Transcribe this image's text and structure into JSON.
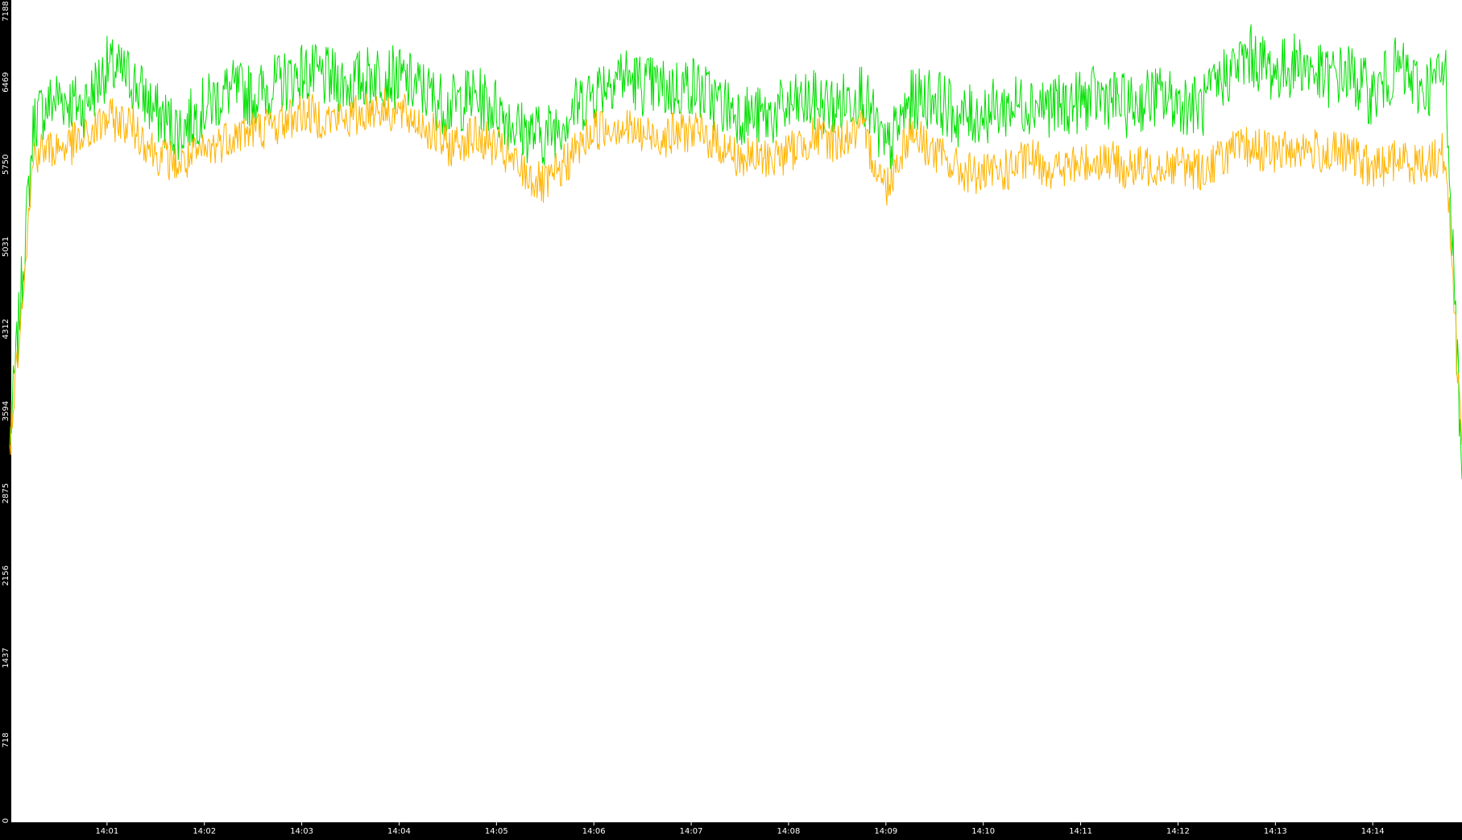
{
  "chart_data": {
    "type": "line",
    "title": "",
    "xlabel": "",
    "ylabel": "",
    "x_ticks": [
      "14:01",
      "14:02",
      "14:03",
      "14:04",
      "14:05",
      "14:06",
      "14:07",
      "14:08",
      "14:09",
      "14:10",
      "14:11",
      "14:12",
      "14:13",
      "14:14"
    ],
    "y_ticks": [
      "0",
      "718",
      "1437",
      "2156",
      "2875",
      "3594",
      "4312",
      "5031",
      "5750",
      "6469",
      "7188"
    ],
    "ylim": [
      0,
      7188
    ],
    "xlim": [
      "14:00:01",
      "14:14:55"
    ],
    "grid": false,
    "background": "#ffffff",
    "frame_color": "#000000",
    "tick_label_color": "#ffffff",
    "series": [
      {
        "color": "#00e000",
        "x": [
          "14:00:00",
          "14:00:15",
          "14:00:30",
          "14:00:45",
          "14:01:00",
          "14:01:15",
          "14:01:30",
          "14:01:45",
          "14:02:00",
          "14:02:15",
          "14:02:30",
          "14:02:45",
          "14:03:00",
          "14:03:15",
          "14:03:30",
          "14:03:45",
          "14:04:00",
          "14:04:15",
          "14:04:30",
          "14:04:45",
          "14:05:00",
          "14:05:15",
          "14:05:30",
          "14:05:45",
          "14:06:00",
          "14:06:15",
          "14:06:30",
          "14:06:45",
          "14:07:00",
          "14:07:15",
          "14:07:30",
          "14:07:45",
          "14:08:00",
          "14:08:15",
          "14:08:30",
          "14:08:45",
          "14:09:00",
          "14:09:15",
          "14:09:30",
          "14:09:45",
          "14:10:00",
          "14:10:15",
          "14:10:30",
          "14:10:45",
          "14:11:00",
          "14:11:15",
          "14:11:30",
          "14:11:45",
          "14:12:00",
          "14:12:15",
          "14:12:30",
          "14:12:45",
          "14:13:00",
          "14:13:15",
          "14:13:30",
          "14:13:45",
          "14:14:00",
          "14:14:15",
          "14:14:30",
          "14:14:45",
          "14:14:55"
        ],
        "values": [
          3300,
          6150,
          6350,
          6250,
          6600,
          6500,
          6200,
          6050,
          6250,
          6400,
          6350,
          6450,
          6550,
          6500,
          6450,
          6550,
          6500,
          6400,
          6250,
          6350,
          6250,
          6050,
          6000,
          6200,
          6400,
          6550,
          6450,
          6400,
          6450,
          6300,
          6200,
          6150,
          6250,
          6300,
          6250,
          6400,
          5850,
          6300,
          6350,
          6150,
          6200,
          6250,
          6300,
          6250,
          6300,
          6350,
          6250,
          6350,
          6300,
          6250,
          6550,
          6700,
          6550,
          6650,
          6500,
          6550,
          6350,
          6600,
          6400,
          6550,
          3000
        ]
      },
      {
        "color": "#ffb400",
        "x": [
          "14:00:00",
          "14:00:15",
          "14:00:30",
          "14:00:45",
          "14:01:00",
          "14:01:15",
          "14:01:30",
          "14:01:45",
          "14:02:00",
          "14:02:15",
          "14:02:30",
          "14:02:45",
          "14:03:00",
          "14:03:15",
          "14:03:30",
          "14:03:45",
          "14:04:00",
          "14:04:15",
          "14:04:30",
          "14:04:45",
          "14:05:00",
          "14:05:15",
          "14:05:30",
          "14:05:45",
          "14:06:00",
          "14:06:15",
          "14:06:30",
          "14:06:45",
          "14:07:00",
          "14:07:15",
          "14:07:30",
          "14:07:45",
          "14:08:00",
          "14:08:15",
          "14:08:30",
          "14:08:45",
          "14:09:00",
          "14:09:15",
          "14:09:30",
          "14:09:45",
          "14:10:00",
          "14:10:15",
          "14:10:30",
          "14:10:45",
          "14:11:00",
          "14:11:15",
          "14:11:30",
          "14:11:45",
          "14:12:00",
          "14:12:15",
          "14:12:30",
          "14:12:45",
          "14:13:00",
          "14:13:15",
          "14:13:30",
          "14:13:45",
          "14:14:00",
          "14:14:15",
          "14:14:30",
          "14:14:45",
          "14:14:55"
        ],
        "values": [
          3300,
          5850,
          5900,
          5950,
          6150,
          6100,
          5850,
          5750,
          5850,
          6000,
          6050,
          6100,
          6200,
          6150,
          6150,
          6250,
          6200,
          6100,
          5900,
          6000,
          5900,
          5700,
          5550,
          5800,
          6050,
          6100,
          6000,
          6000,
          6050,
          5950,
          5800,
          5800,
          5850,
          6000,
          5950,
          6050,
          5550,
          6050,
          5850,
          5700,
          5650,
          5700,
          5800,
          5700,
          5750,
          5800,
          5700,
          5750,
          5750,
          5700,
          5850,
          5900,
          5850,
          5900,
          5850,
          5850,
          5700,
          5800,
          5750,
          5850,
          3300
        ]
      }
    ]
  }
}
